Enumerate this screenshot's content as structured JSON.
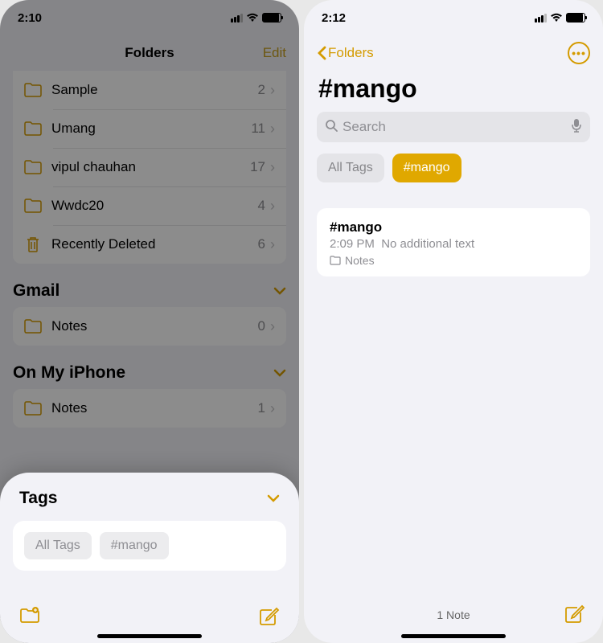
{
  "left": {
    "status_time": "2:10",
    "nav": {
      "title": "Folders",
      "edit": "Edit"
    },
    "folders": [
      {
        "name": "Sample",
        "count": "2"
      },
      {
        "name": "Umang",
        "count": "11"
      },
      {
        "name": "vipul chauhan",
        "count": "17"
      },
      {
        "name": "Wwdc20",
        "count": "4"
      },
      {
        "name": "Recently Deleted",
        "count": "6"
      }
    ],
    "sections": {
      "gmail": {
        "title": "Gmail",
        "items": [
          {
            "name": "Notes",
            "count": "0"
          }
        ]
      },
      "local": {
        "title": "On My iPhone",
        "items": [
          {
            "name": "Notes",
            "count": "1"
          }
        ]
      }
    },
    "tags": {
      "title": "Tags",
      "chips": [
        "All Tags",
        "#mango"
      ]
    }
  },
  "right": {
    "status_time": "2:12",
    "back_label": "Folders",
    "title": "#mango",
    "search_placeholder": "Search",
    "filters": {
      "all": "All Tags",
      "active": "#mango"
    },
    "note": {
      "title": "#mango",
      "time": "2:09 PM",
      "preview": "No additional text",
      "folder": "Notes"
    },
    "footer_count": "1 Note"
  }
}
